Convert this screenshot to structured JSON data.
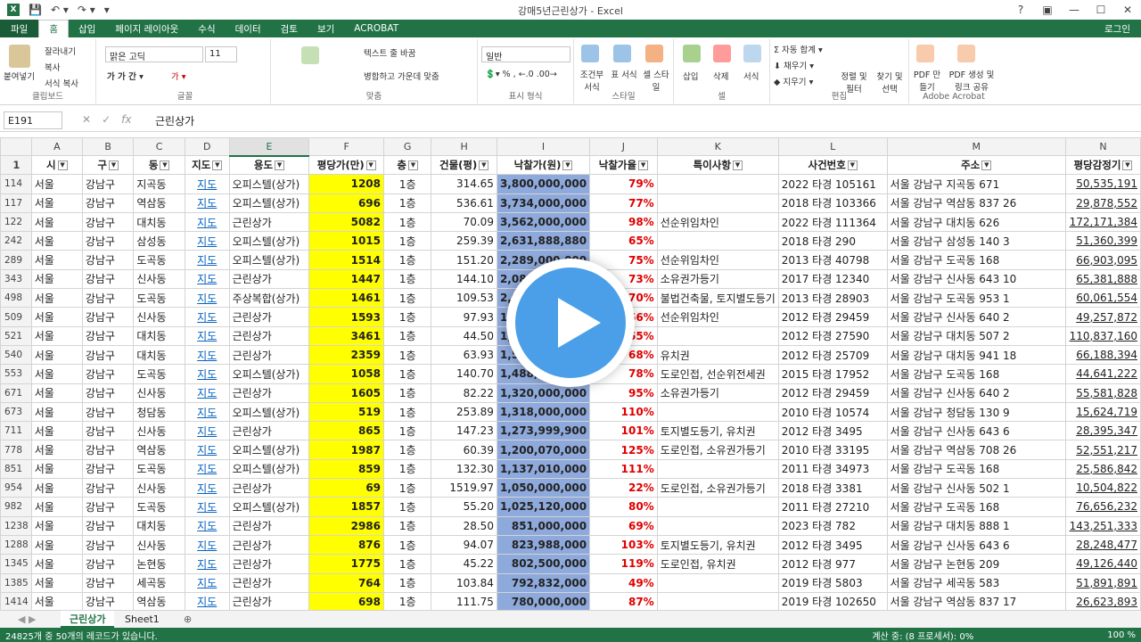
{
  "window": {
    "title": "강매5년근린상가 - Excel",
    "login": "로그인"
  },
  "ribbon_tabs": [
    "파일",
    "홈",
    "삽입",
    "페이지 레이아웃",
    "수식",
    "데이터",
    "검토",
    "보기",
    "ACROBAT"
  ],
  "ribbon": {
    "clipboard": {
      "paste": "붙여넣기",
      "cut": "잘라내기",
      "copy": "복사",
      "format_painter": "서식 복사",
      "label": "클립보드"
    },
    "font": {
      "name": "맑은 고딕",
      "size": "11",
      "label": "글꼴"
    },
    "align": {
      "wrap": "텍스트 줄 바꿈",
      "merge": "병합하고 가운데 맞춤",
      "label": "맞춤"
    },
    "number": {
      "format": "일반",
      "label": "표시 형식"
    },
    "styles": {
      "cond": "조건부 서식",
      "table": "표 서식",
      "cell": "셀 스타일",
      "label": "스타일"
    },
    "cells": {
      "insert": "삽입",
      "delete": "삭제",
      "format": "서식",
      "label": "셀"
    },
    "edit": {
      "autosum": "자동 합계",
      "fill": "채우기",
      "clear": "지우기",
      "sort": "정렬 및 필터",
      "find": "찾기 및 선택",
      "label": "편집"
    },
    "acrobat": {
      "pdf": "PDF 만들기",
      "pdf_share": "PDF 생성 및 링크 공유",
      "label": "Adobe Acrobat"
    }
  },
  "formula_bar": {
    "cell_ref": "E191",
    "content": "근린상가"
  },
  "columns": [
    "A",
    "B",
    "C",
    "D",
    "E",
    "F",
    "G",
    "H",
    "I",
    "J",
    "K",
    "L",
    "M",
    "N"
  ],
  "headers": [
    "시",
    "구",
    "동",
    "지도",
    "용도",
    "평당가(만)",
    "층",
    "건물(평)",
    "낙찰가(원)",
    "낙찰가율",
    "특이사항",
    "사건번호",
    "주소",
    "평당감정기"
  ],
  "rows": [
    {
      "r": "114",
      "a": "서울",
      "b": "강남구",
      "c": "지곡동",
      "d": "지도",
      "e": "오피스텔(상가)",
      "f": "1208",
      "g": "1층",
      "h": "314.65",
      "i": "3,800,000,000",
      "j": "79%",
      "k": "",
      "l": "2022 타경 105161",
      "m": "서울 강남구 지곡동 671",
      "n": "50,535,191"
    },
    {
      "r": "117",
      "a": "서울",
      "b": "강남구",
      "c": "역삼동",
      "d": "지도",
      "e": "오피스텔(상가)",
      "f": "696",
      "g": "1층",
      "h": "536.61",
      "i": "3,734,000,000",
      "j": "77%",
      "k": "",
      "l": "2018 타경 103366",
      "m": "서울 강남구 역삼동 837 26",
      "n": "29,878,552"
    },
    {
      "r": "122",
      "a": "서울",
      "b": "강남구",
      "c": "대치동",
      "d": "지도",
      "e": "근린상가",
      "f": "5082",
      "g": "1층",
      "h": "70.09",
      "i": "3,562,000,000",
      "j": "98%",
      "k": "선순위임차인",
      "l": "2022 타경 111364",
      "m": "서울 강남구 대치동 626",
      "n": "172,171,384"
    },
    {
      "r": "242",
      "a": "서울",
      "b": "강남구",
      "c": "삼성동",
      "d": "지도",
      "e": "오피스텔(상가)",
      "f": "1015",
      "g": "1층",
      "h": "259.39",
      "i": "2,631,888,880",
      "j": "65%",
      "k": "",
      "l": "2018 타경 290",
      "m": "서울 강남구 삼성동 140 3",
      "n": "51,360,399"
    },
    {
      "r": "289",
      "a": "서울",
      "b": "강남구",
      "c": "도곡동",
      "d": "지도",
      "e": "오피스텔(상가)",
      "f": "1514",
      "g": "1층",
      "h": "151.20",
      "i": "2,289,000,000",
      "j": "75%",
      "k": "선순위임차인",
      "l": "2013 타경 40798",
      "m": "서울 강남구 도곡동 168",
      "n": "66,903,095"
    },
    {
      "r": "343",
      "a": "서울",
      "b": "강남구",
      "c": "신사동",
      "d": "지도",
      "e": "근린상가",
      "f": "1447",
      "g": "1층",
      "h": "144.10",
      "i": "2,085,000,000",
      "j": "73%",
      "k": "소유권가등기",
      "l": "2017 타경 12340",
      "m": "서울 강남구 신사동 643 10",
      "n": "65,381,888"
    },
    {
      "r": "498",
      "a": "서울",
      "b": "강남구",
      "c": "도곡동",
      "d": "지도",
      "e": "주상복합(상가)",
      "f": "1461",
      "g": "1층",
      "h": "109.53",
      "i": "2,000,000,000",
      "j": "70%",
      "k": "불법건축물, 토지별도등기",
      "l": "2013 타경 28903",
      "m": "서울 강남구 도곡동 953 1",
      "n": "60,061,554"
    },
    {
      "r": "509",
      "a": "서울",
      "b": "강남구",
      "c": "신사동",
      "d": "지도",
      "e": "근린상가",
      "f": "1593",
      "g": "1층",
      "h": "97.93",
      "i": "1,560,000,000",
      "j": "66%",
      "k": "선순위임차인",
      "l": "2012 타경 29459",
      "m": "서울 강남구 신사동 640 2",
      "n": "49,257,872"
    },
    {
      "r": "521",
      "a": "서울",
      "b": "강남구",
      "c": "대치동",
      "d": "지도",
      "e": "근린상가",
      "f": "3461",
      "g": "1층",
      "h": "44.50",
      "i": "1,540,000,000",
      "j": "65%",
      "k": "",
      "l": "2012 타경 27590",
      "m": "서울 강남구 대치동 507 2",
      "n": "110,837,160"
    },
    {
      "r": "540",
      "a": "서울",
      "b": "강남구",
      "c": "대치동",
      "d": "지도",
      "e": "근린상가",
      "f": "2359",
      "g": "1층",
      "h": "63.93",
      "i": "1,508,000,000",
      "j": "68%",
      "k": "유치권",
      "l": "2012 타경 25709",
      "m": "서울 강남구 대치동 941 18",
      "n": "66,188,394"
    },
    {
      "r": "553",
      "a": "서울",
      "b": "강남구",
      "c": "도곡동",
      "d": "지도",
      "e": "오피스텔(상가)",
      "f": "1058",
      "g": "1층",
      "h": "140.70",
      "i": "1,488,000,000",
      "j": "78%",
      "k": "도로인접, 선순위전세권",
      "l": "2015 타경 17952",
      "m": "서울 강남구 도곡동 168",
      "n": "44,641,222"
    },
    {
      "r": "671",
      "a": "서울",
      "b": "강남구",
      "c": "신사동",
      "d": "지도",
      "e": "근린상가",
      "f": "1605",
      "g": "1층",
      "h": "82.22",
      "i": "1,320,000,000",
      "j": "95%",
      "k": "소유권가등기",
      "l": "2012 타경 29459",
      "m": "서울 강남구 신사동 640 2",
      "n": "55,581,828"
    },
    {
      "r": "673",
      "a": "서울",
      "b": "강남구",
      "c": "청담동",
      "d": "지도",
      "e": "오피스텔(상가)",
      "f": "519",
      "g": "1층",
      "h": "253.89",
      "i": "1,318,000,000",
      "j": "110%",
      "k": "",
      "l": "2010 타경 10574",
      "m": "서울 강남구 청담동 130 9",
      "n": "15,624,719"
    },
    {
      "r": "711",
      "a": "서울",
      "b": "강남구",
      "c": "신사동",
      "d": "지도",
      "e": "근린상가",
      "f": "865",
      "g": "1층",
      "h": "147.23",
      "i": "1,273,999,900",
      "j": "101%",
      "k": "토지별도등기, 유치권",
      "l": "2012 타경 3495",
      "m": "서울 강남구 신사동 643 6",
      "n": "28,395,347"
    },
    {
      "r": "778",
      "a": "서울",
      "b": "강남구",
      "c": "역삼동",
      "d": "지도",
      "e": "오피스텔(상가)",
      "f": "1987",
      "g": "1층",
      "h": "60.39",
      "i": "1,200,070,000",
      "j": "125%",
      "k": "도로인접, 소유권가등기",
      "l": "2010 타경 33195",
      "m": "서울 강남구 역삼동 708 26",
      "n": "52,551,217"
    },
    {
      "r": "851",
      "a": "서울",
      "b": "강남구",
      "c": "도곡동",
      "d": "지도",
      "e": "오피스텔(상가)",
      "f": "859",
      "g": "1층",
      "h": "132.30",
      "i": "1,137,010,000",
      "j": "111%",
      "k": "",
      "l": "2011 타경 34973",
      "m": "서울 강남구 도곡동 168",
      "n": "25,586,842"
    },
    {
      "r": "954",
      "a": "서울",
      "b": "강남구",
      "c": "신사동",
      "d": "지도",
      "e": "근린상가",
      "f": "69",
      "g": "1층",
      "h": "1519.97",
      "i": "1,050,000,000",
      "j": "22%",
      "k": "도로인접, 소유권가등기",
      "l": "2018 타경 3381",
      "m": "서울 강남구 신사동 502 1",
      "n": "10,504,822"
    },
    {
      "r": "982",
      "a": "서울",
      "b": "강남구",
      "c": "도곡동",
      "d": "지도",
      "e": "오피스텔(상가)",
      "f": "1857",
      "g": "1층",
      "h": "55.20",
      "i": "1,025,120,000",
      "j": "80%",
      "k": "",
      "l": "2011 타경 27210",
      "m": "서울 강남구 도곡동 168",
      "n": "76,656,232"
    },
    {
      "r": "1238",
      "a": "서울",
      "b": "강남구",
      "c": "대치동",
      "d": "지도",
      "e": "근린상가",
      "f": "2986",
      "g": "1층",
      "h": "28.50",
      "i": "851,000,000",
      "j": "69%",
      "k": "",
      "l": "2023 타경 782",
      "m": "서울 강남구 대치동 888 1",
      "n": "143,251,333"
    },
    {
      "r": "1288",
      "a": "서울",
      "b": "강남구",
      "c": "신사동",
      "d": "지도",
      "e": "근린상가",
      "f": "876",
      "g": "1층",
      "h": "94.07",
      "i": "823,988,000",
      "j": "103%",
      "k": "토지별도등기, 유치권",
      "l": "2012 타경 3495",
      "m": "서울 강남구 신사동 643 6",
      "n": "28,248,477"
    },
    {
      "r": "1345",
      "a": "서울",
      "b": "강남구",
      "c": "논현동",
      "d": "지도",
      "e": "근린상가",
      "f": "1775",
      "g": "1층",
      "h": "45.22",
      "i": "802,500,000",
      "j": "119%",
      "k": "도로인접, 유치권",
      "l": "2012 타경 977",
      "m": "서울 강남구 논현동 209",
      "n": "49,126,440"
    },
    {
      "r": "1385",
      "a": "서울",
      "b": "강남구",
      "c": "세곡동",
      "d": "지도",
      "e": "근린상가",
      "f": "764",
      "g": "1층",
      "h": "103.84",
      "i": "792,832,000",
      "j": "49%",
      "k": "",
      "l": "2019 타경 5803",
      "m": "서울 강남구 세곡동 583",
      "n": "51,891,891"
    },
    {
      "r": "1414",
      "a": "서울",
      "b": "강남구",
      "c": "역삼동",
      "d": "지도",
      "e": "근린상가",
      "f": "698",
      "g": "1층",
      "h": "111.75",
      "i": "780,000,000",
      "j": "87%",
      "k": "",
      "l": "2019 타경 102650",
      "m": "서울 강남구 역삼동 837 17",
      "n": "26,623,893"
    }
  ],
  "sheet_tabs": [
    "근린상가",
    "Sheet1"
  ],
  "status": {
    "left": "24825개 중 50개의 레코드가 있습니다.",
    "calc": "계산 중: (8 프로세서): 0%",
    "zoom": "100 %"
  }
}
